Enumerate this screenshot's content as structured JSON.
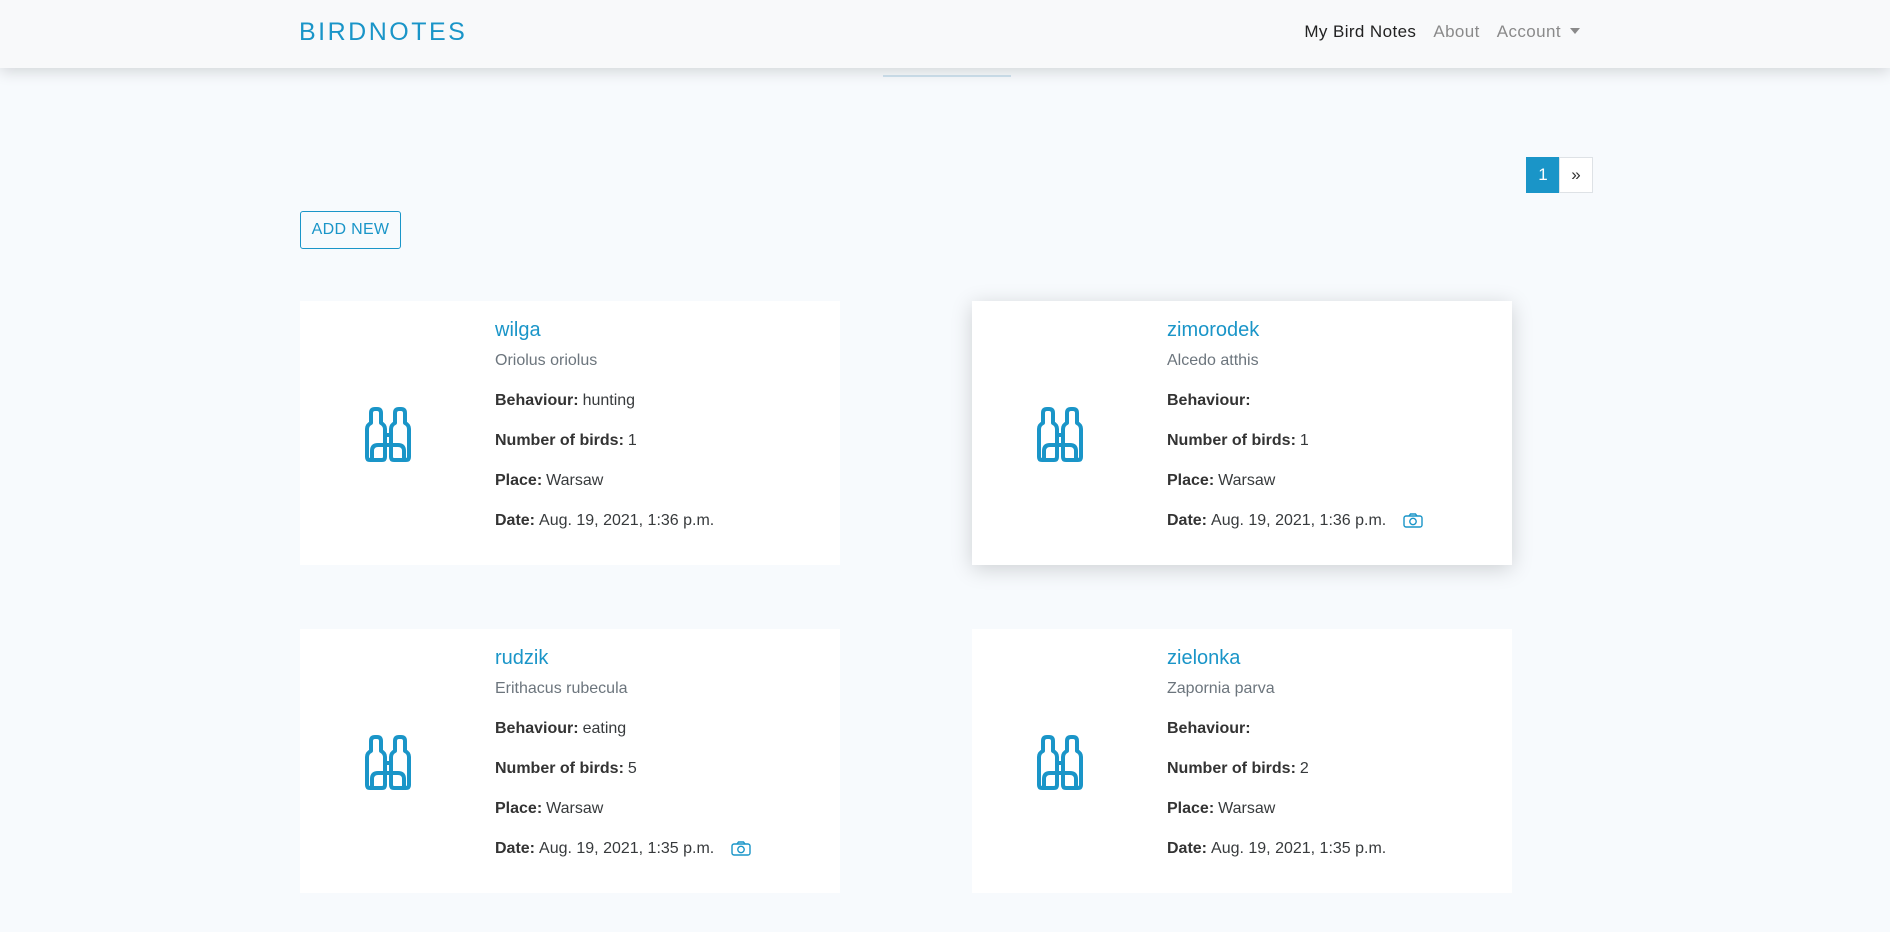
{
  "navbar": {
    "brand": "BIRDNOTES",
    "links": [
      "My Bird Notes",
      "About",
      "Account"
    ],
    "active": "My Bird Notes"
  },
  "pagination": {
    "current": "1",
    "next": "»"
  },
  "add_button": "ADD NEW",
  "labels": {
    "behaviour": "Behaviour:",
    "number": "Number of birds:",
    "place": "Place:",
    "date": "Date:"
  },
  "cards": [
    {
      "name": "wilga",
      "latin": "Oriolus oriolus",
      "behaviour": "hunting",
      "number": "1",
      "place": "Warsaw",
      "date": "Aug. 19, 2021, 1:36 p.m.",
      "photo_icon": false
    },
    {
      "name": "zimorodek",
      "latin": "Alcedo atthis",
      "behaviour": "",
      "number": "1",
      "place": "Warsaw",
      "date": "Aug. 19, 2021, 1:36 p.m.",
      "photo_icon": true
    },
    {
      "name": "rudzik",
      "latin": "Erithacus rubecula",
      "behaviour": "eating",
      "number": "5",
      "place": "Warsaw",
      "date": "Aug. 19, 2021, 1:35 p.m.",
      "photo_icon": true
    },
    {
      "name": "zielonka",
      "latin": "Zapornia parva",
      "behaviour": "",
      "number": "2",
      "place": "Warsaw",
      "date": "Aug. 19, 2021, 1:35 p.m.",
      "photo_icon": false
    }
  ],
  "colors": {
    "accent": "#1a95c8",
    "background": "#f7fafd",
    "navbar": "#f8f9fa"
  },
  "icons": {
    "card_image": "binoculars-icon",
    "photo": "camera-icon",
    "account_menu": "caret-down-icon"
  }
}
